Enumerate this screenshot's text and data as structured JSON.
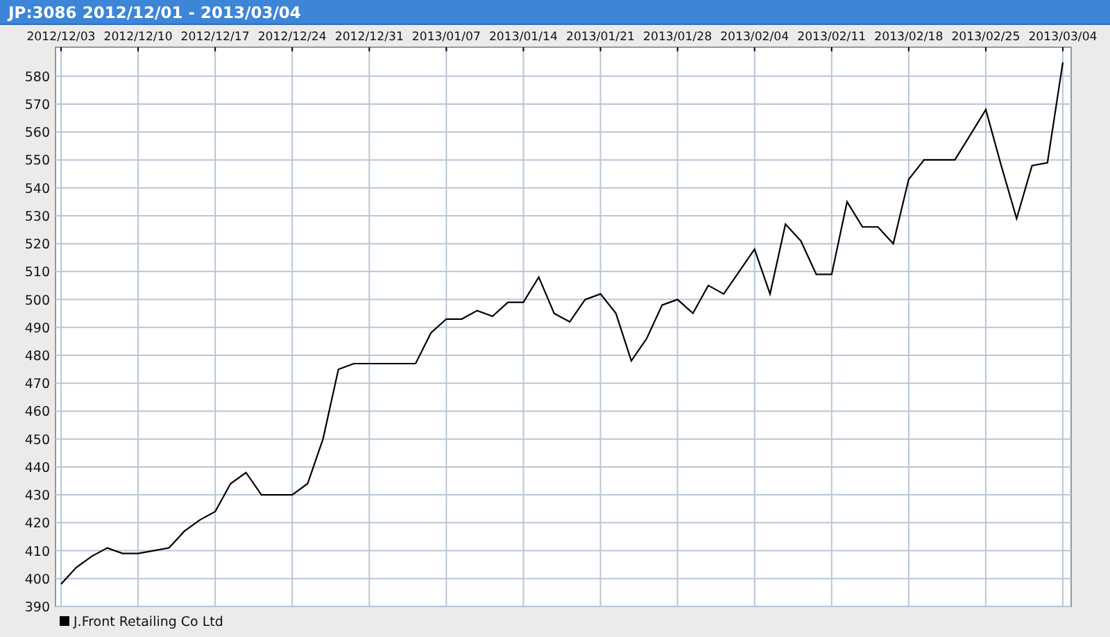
{
  "window": {
    "title": "JP:3086 2012/12/01 - 2013/03/04"
  },
  "chart": {
    "chart_data": {
      "type": "line",
      "categories": [
        "2012/12/03",
        null,
        null,
        null,
        null,
        "2012/12/10",
        null,
        null,
        null,
        null,
        "2012/12/17",
        null,
        null,
        null,
        null,
        "2012/12/24",
        null,
        null,
        null,
        null,
        "2012/12/31",
        null,
        null,
        null,
        null,
        "2013/01/07",
        null,
        null,
        null,
        null,
        "2013/01/14",
        null,
        null,
        null,
        null,
        "2013/01/21",
        null,
        null,
        null,
        null,
        "2013/01/28",
        null,
        null,
        null,
        null,
        "2013/02/04",
        null,
        null,
        null,
        null,
        "2013/02/11",
        null,
        null,
        null,
        null,
        "2013/02/18",
        null,
        null,
        null,
        null,
        "2013/02/25",
        null,
        null,
        null,
        null,
        "2013/03/04"
      ],
      "series": [
        {
          "name": "J.Front Retailing Co Ltd",
          "color": "#000000",
          "values": [
            398,
            404,
            408,
            411,
            409,
            409,
            410,
            411,
            417,
            421,
            424,
            434,
            438,
            430,
            430,
            430,
            434,
            450,
            475,
            477,
            477,
            477,
            477,
            477,
            488,
            493,
            493,
            496,
            494,
            499,
            499,
            508,
            495,
            492,
            500,
            502,
            495,
            478,
            486,
            498,
            500,
            495,
            505,
            502,
            510,
            518,
            502,
            527,
            521,
            509,
            509,
            535,
            526,
            526,
            520,
            543,
            550,
            550,
            550,
            559,
            568,
            548,
            529,
            548,
            549,
            585
          ]
        }
      ],
      "grid": true,
      "ylim": [
        390,
        590.4
      ],
      "yticks": [
        390,
        400,
        410,
        420,
        430,
        440,
        450,
        460,
        470,
        480,
        490,
        500,
        510,
        520,
        530,
        540,
        550,
        560,
        570,
        580
      ]
    }
  }
}
